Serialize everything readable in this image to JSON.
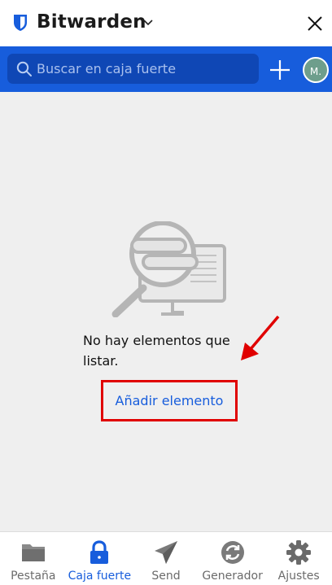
{
  "header": {
    "title": "Bitwarden"
  },
  "search": {
    "placeholder": "Buscar en caja fuerte"
  },
  "account": {
    "initials": "M."
  },
  "empty_state": {
    "message": "No hay elementos que listar.",
    "add_label": "Añadir elemento"
  },
  "tabs": [
    {
      "label": "Pestaña",
      "icon": "folder-icon"
    },
    {
      "label": "Caja fuerte",
      "icon": "lock-icon",
      "active": true
    },
    {
      "label": "Send",
      "icon": "send-icon"
    },
    {
      "label": "Generador",
      "icon": "refresh-icon"
    },
    {
      "label": "Ajustes",
      "icon": "gear-icon"
    }
  ],
  "colors": {
    "brand": "#175ddc",
    "search_bg": "#0f47b5",
    "highlight": "#e00000",
    "background": "#efefef"
  }
}
